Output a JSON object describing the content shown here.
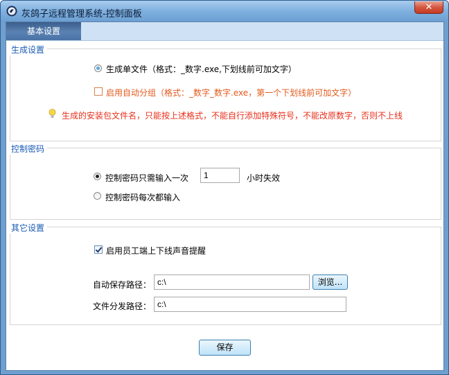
{
  "window": {
    "title": "灰鸽子远程管理系统-控制面板",
    "close_glyph": "✕"
  },
  "tabs": [
    {
      "label": "基本设置",
      "selected": true
    }
  ],
  "generate": {
    "title": "生成设置",
    "option_single": "生成单文件（格式：_数字.exe,下划线前可加文字）",
    "option_group": "启用自动分组（格式：_数字_数字.exe，第一个下划线前可加文字）",
    "hint": "生成的安装包文件名，只能按上述格式，不能自行添加特殊符号，不能改原数字，否则不上线"
  },
  "password": {
    "title": "控制密码",
    "option_once": "控制密码只需输入一次",
    "hours_value": "1",
    "hours_suffix": "小时失效",
    "option_every": "控制密码每次都输入"
  },
  "other": {
    "title": "其它设置",
    "sound_label": "启用员工端上下线声音提醒",
    "save_path_label": "自动保存路径：",
    "save_path_value": "c:\\",
    "browse_label": "浏览...",
    "dist_path_label": "文件分发路径：",
    "dist_path_value": "c:\\"
  },
  "save_label": "保存",
  "colors": {
    "group_title": "#1a5bb5",
    "warning_text": "#e8301c",
    "option_orange": "#e35a1c",
    "window_frame": "#6f9fd0"
  },
  "icons": [
    "app-icon",
    "close-icon",
    "lightbulb-icon"
  ]
}
